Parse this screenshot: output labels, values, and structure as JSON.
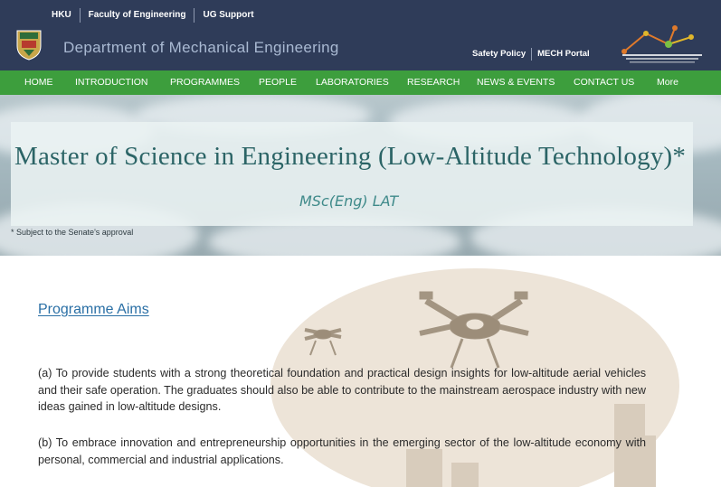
{
  "header": {
    "top_links": [
      "HKU",
      "Faculty of Engineering",
      "UG Support"
    ],
    "dept_title": "Department of Mechanical Engineering",
    "right_links": [
      "Safety Policy",
      "MECH Portal"
    ],
    "logo_icon": "mech-logo-icon",
    "crest_icon": "hku-crest-icon",
    "bg_color": "#2f3c59"
  },
  "nav": {
    "items": [
      "HOME",
      "INTRODUCTION",
      "PROGRAMMES",
      "PEOPLE",
      "LABORATORIES",
      "RESEARCH",
      "NEWS & EVENTS",
      "CONTACT US",
      "More"
    ],
    "bg_color": "#3d9e3d"
  },
  "hero": {
    "title": "Master of Science in Engineering (Low-Altitude Technology)*",
    "subtitle": "MSc(Eng) LAT",
    "note": "* Subject to the Senate's approval"
  },
  "main": {
    "aims_heading": "Programme Aims",
    "paragraphs": [
      "(a) To provide students with a strong theoretical foundation and practical design insights for low-altitude aerial vehicles and their safe operation. The graduates should also be able to contribute to the mainstream aerospace industry with new ideas gained in low-altitude designs.",
      "(b) To embrace innovation and entrepreneurship opportunities in the emerging sector of the low-altitude economy with personal, commercial and industrial applications."
    ],
    "illustration_icon": "drone-illustration-icon"
  }
}
